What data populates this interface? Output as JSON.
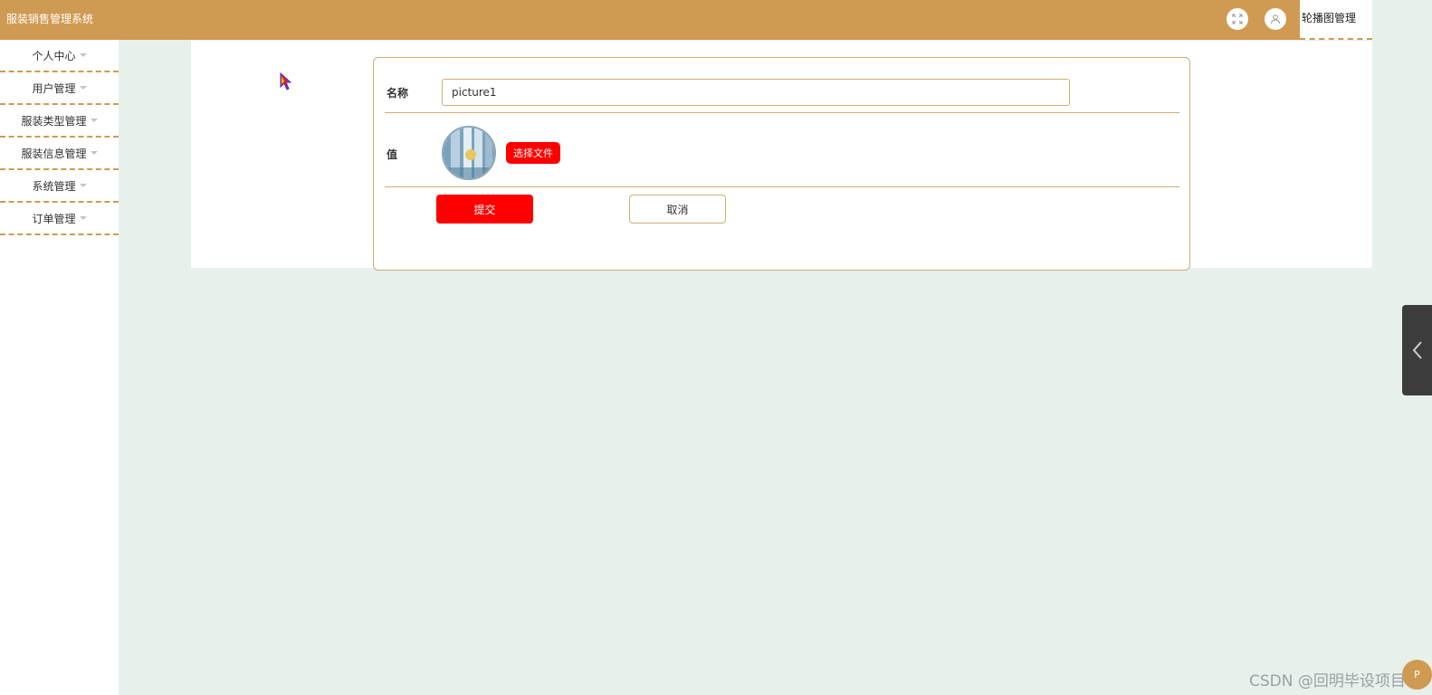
{
  "header": {
    "app_title": "服装销售管理系统",
    "active_tab": "轮播图管理",
    "icons": [
      "fullscreen-icon",
      "user-icon"
    ]
  },
  "sidebar": {
    "items": [
      {
        "label": "个人中心"
      },
      {
        "label": "用户管理"
      },
      {
        "label": "服装类型管理"
      },
      {
        "label": "服装信息管理"
      },
      {
        "label": "系统管理"
      },
      {
        "label": "订单管理"
      }
    ]
  },
  "form": {
    "name_label": "名称",
    "name_value": "picture1",
    "value_label": "值",
    "choose_file_label": "选择文件",
    "submit_label": "提交",
    "cancel_label": "取消"
  },
  "watermark": "CSDN @回明毕设项目",
  "float_badge": "P",
  "colors": {
    "accent": "#cf9a52",
    "primary_button": "#ff0000",
    "background": "#e7f0ea"
  }
}
